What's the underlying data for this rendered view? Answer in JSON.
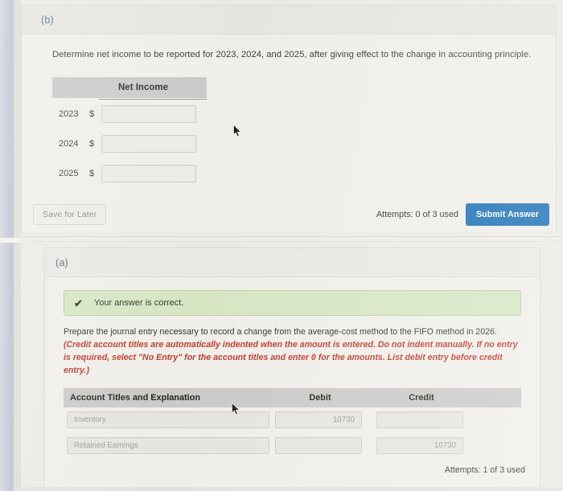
{
  "part_b": {
    "label": "(b)",
    "prompt": "Determine net income to be reported for 2023, 2024, and 2025, after giving effect to the change in accounting principle.",
    "table": {
      "column_header": "Net Income",
      "currency_symbol": "$",
      "rows": [
        {
          "year": "2023",
          "currency": "$",
          "value": ""
        },
        {
          "year": "2024",
          "currency": "$",
          "value": ""
        },
        {
          "year": "2025",
          "currency": "$",
          "value": ""
        }
      ]
    },
    "footer": {
      "save_label": "Save for Later",
      "attempts": "Attempts: 0 of 3 used",
      "submit_label": "Submit Answer"
    }
  },
  "part_a": {
    "label": "(a)",
    "alert": {
      "icon": "check-icon",
      "text": "Your answer is correct."
    },
    "instruction_main": "Prepare the journal entry necessary to record a change from the average-cost method to the FIFO method in 2026. ",
    "instruction_red": "(Credit account titles are automatically indented when the amount is entered. Do not indent manually. If no entry is required, select \"No Entry\" for the account titles and enter 0 for the amounts. List debit entry before credit entry.)",
    "journal": {
      "headers": {
        "account": "Account Titles and Explanation",
        "debit": "Debit",
        "credit": "Credit"
      },
      "rows": [
        {
          "account": "Inventory",
          "debit": "10730",
          "credit": ""
        },
        {
          "account": "Retained Earnings",
          "debit": "",
          "credit": "10730"
        }
      ]
    },
    "attempts": "Attempts: 1 of 3 used"
  },
  "colors": {
    "submit_blue": "#1a6fb5",
    "alert_green_bg": "#d6e5c2",
    "alert_green_border": "#b9cfa0",
    "table_header_gray": "#c9c9c7",
    "red_instruction": "#c0392b",
    "part_label_blue": "#4e6f80",
    "page_bg": "#eceae5"
  }
}
